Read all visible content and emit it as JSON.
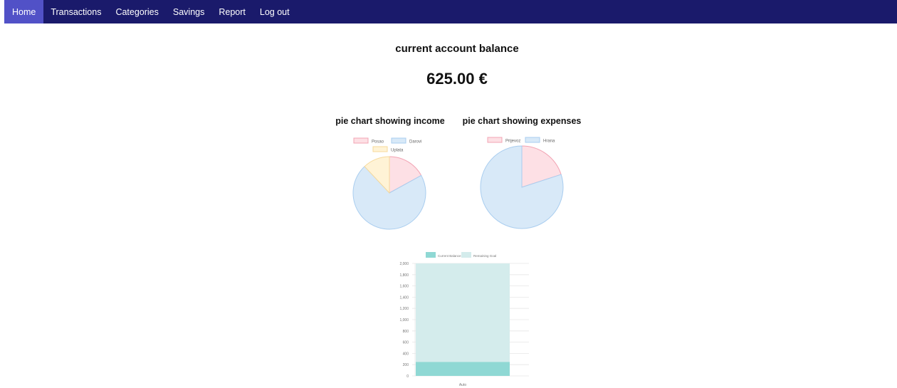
{
  "nav": {
    "items": [
      {
        "label": "Home",
        "active": true
      },
      {
        "label": "Transactions",
        "active": false
      },
      {
        "label": "Categories",
        "active": false
      },
      {
        "label": "Savings",
        "active": false
      },
      {
        "label": "Report",
        "active": false
      },
      {
        "label": "Log out",
        "active": false
      }
    ]
  },
  "balance": {
    "title": "current account balance",
    "value": "625.00 €"
  },
  "colors": {
    "nav_bg": "#1a1a6b",
    "nav_active": "#5151c7",
    "pink_fill": "#fde0e5",
    "pink_stroke": "#f2a4b4",
    "blue_fill": "#d8e9f8",
    "blue_stroke": "#a9cdef",
    "yellow_fill": "#fff3d6",
    "yellow_stroke": "#f7d99a",
    "teal_dark": "#8fd8d4",
    "teal_light": "#d4ecec"
  },
  "chart_data": [
    {
      "type": "pie",
      "title": "pie chart showing income",
      "legend_position": "top",
      "labels": [
        "Posao",
        "Darovi",
        "Uplata"
      ],
      "values": [
        17,
        71,
        12
      ],
      "colors": [
        "pink",
        "blue",
        "yellow"
      ]
    },
    {
      "type": "pie",
      "title": "pie chart showing expenses",
      "legend_position": "top",
      "labels": [
        "Prijevoz",
        "Hrana"
      ],
      "values": [
        20,
        80
      ],
      "colors": [
        "pink",
        "blue"
      ]
    },
    {
      "type": "bar",
      "stacked": true,
      "title": "",
      "legend_position": "top",
      "categories": [
        "Auto"
      ],
      "series": [
        {
          "name": "Current Balance",
          "values": [
            250
          ]
        },
        {
          "name": "Remaining Goal",
          "values": [
            1750
          ]
        }
      ],
      "colors": [
        "teal_dark",
        "teal_light"
      ],
      "ylim": [
        0,
        2000
      ],
      "yticks": [
        "2,000",
        "1,800",
        "1,600",
        "1,400",
        "1,200",
        "1,000",
        "800",
        "600",
        "400",
        "200",
        "0"
      ],
      "grid": true
    }
  ]
}
